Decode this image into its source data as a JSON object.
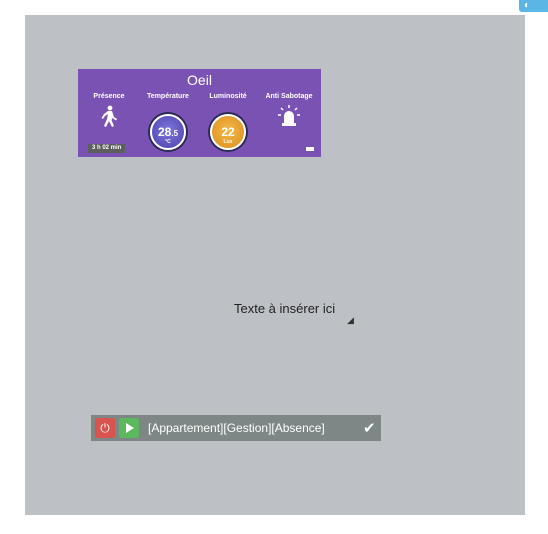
{
  "widget": {
    "title": "Oeil",
    "presence": {
      "label": "Présence",
      "icon": "walking-person-icon"
    },
    "temperature": {
      "label": "Température",
      "value_int": "28",
      "value_dec": ".5",
      "unit": "°C"
    },
    "luminosity": {
      "label": "Luminosité",
      "value": "22",
      "unit": "Lux"
    },
    "anti_sabotage": {
      "label": "Anti Sabotage",
      "icon": "alarm-light-icon"
    },
    "presence_since": "3 h 02 min",
    "battery_icon": "battery-icon",
    "colors": {
      "background": "#7a52b4",
      "temp_gauge": "#5a50c0",
      "lux_gauge": "#e89a2a"
    }
  },
  "textbox": {
    "text": "Texte à insérer ici"
  },
  "scenario": {
    "label": "[Appartement][Gestion][Absence]",
    "stop_icon": "power-icon",
    "play_icon": "play-icon",
    "check_icon": "check-icon",
    "colors": {
      "bar": "#7d8785",
      "stop": "#d9534f",
      "play": "#5cb85c"
    }
  },
  "canvas": {
    "background": "#bdc1c5"
  }
}
